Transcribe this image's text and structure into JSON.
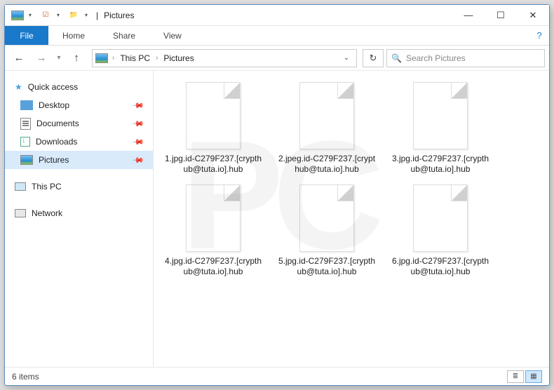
{
  "titlebar": {
    "title": "Pictures"
  },
  "ribbon": {
    "file": "File",
    "tabs": [
      "Home",
      "Share",
      "View"
    ]
  },
  "breadcrumb": {
    "root": "This PC",
    "current": "Pictures"
  },
  "search": {
    "placeholder": "Search Pictures"
  },
  "sidebar": {
    "quick": "Quick access",
    "items": [
      "Desktop",
      "Documents",
      "Downloads",
      "Pictures"
    ],
    "thispc": "This PC",
    "network": "Network"
  },
  "files": [
    "1.jpg.id-C279F237.[crypthub@tuta.io].hub",
    "2.jpeg.id-C279F237.[crypthub@tuta.io].hub",
    "3.jpg.id-C279F237.[crypthub@tuta.io].hub",
    "4.jpg.id-C279F237.[crypthub@tuta.io].hub",
    "5.jpg.id-C279F237.[crypthub@tuta.io].hub",
    "6.jpg.id-C279F237.[crypthub@tuta.io].hub"
  ],
  "status": {
    "count": "6 items"
  },
  "watermark": "PC"
}
